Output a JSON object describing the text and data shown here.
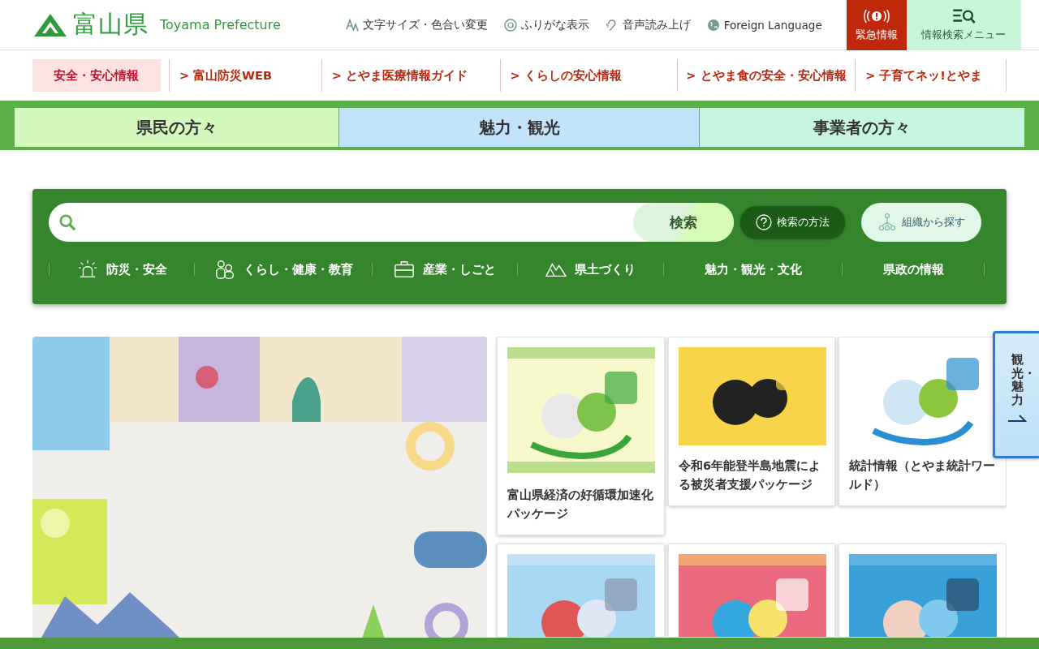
{
  "header": {
    "logo_text": "富山県",
    "logo_subtitle": "Toyama Prefecture",
    "utility_links": [
      {
        "label": "文字サイズ・色合い変更",
        "kind": "text-size"
      },
      {
        "label": "ふりがな表示",
        "kind": "furigana"
      },
      {
        "label": "音声読み上げ",
        "kind": "voice"
      },
      {
        "label": "Foreign Language",
        "kind": "globe"
      }
    ],
    "emergency_button": "緊急情報",
    "search_menu_button": "情報検索メニュー"
  },
  "safety_nav": [
    {
      "label": "安全・安心情報",
      "selected": true
    },
    {
      "label": "> 富山防災WEB",
      "selected": false
    },
    {
      "label": "> とやま医療情報ガイド",
      "selected": false
    },
    {
      "label": "> くらしの安心情報",
      "selected": false
    },
    {
      "label": "> とやま食の安全・安心情報",
      "selected": false
    },
    {
      "label": "> 子育てネッ!とやま",
      "selected": false
    }
  ],
  "audience_tabs": [
    {
      "label": "県民の方々",
      "color": "#d4f9bf"
    },
    {
      "label": "魅力・観光",
      "color": "#c2e3fa"
    },
    {
      "label": "事業者の方々",
      "color": "#c8f5e0"
    }
  ],
  "search": {
    "button": "検索",
    "help_button": "検索の方法",
    "org_button": "組織から探す",
    "categories": [
      {
        "label": "防災・安全",
        "kind": "alarm"
      },
      {
        "label": "くらし・健康・教育",
        "kind": "people"
      },
      {
        "label": "産業・しごと",
        "kind": "briefcase"
      },
      {
        "label": "県土づくり",
        "kind": "mountain"
      },
      {
        "label": "魅力・観光・文化",
        "kind": "plain"
      },
      {
        "label": "県政の情報",
        "kind": "plain"
      }
    ]
  },
  "featured": {
    "banner": {
      "kind": "picture"
    },
    "cards": [
      {
        "title": "富山県経済の好循環加速化パッケージ",
        "kind": "picture"
      },
      {
        "title": "令和6年能登半島地震による被災者支援パッケージ",
        "kind": "picture"
      },
      {
        "title": "統計情報（とやま統計ワールド）",
        "kind": "picture"
      },
      {
        "kind": "picture"
      },
      {
        "kind": "picture"
      },
      {
        "kind": "picture"
      }
    ]
  },
  "side_tab": {
    "label": "観光・魅力"
  }
}
